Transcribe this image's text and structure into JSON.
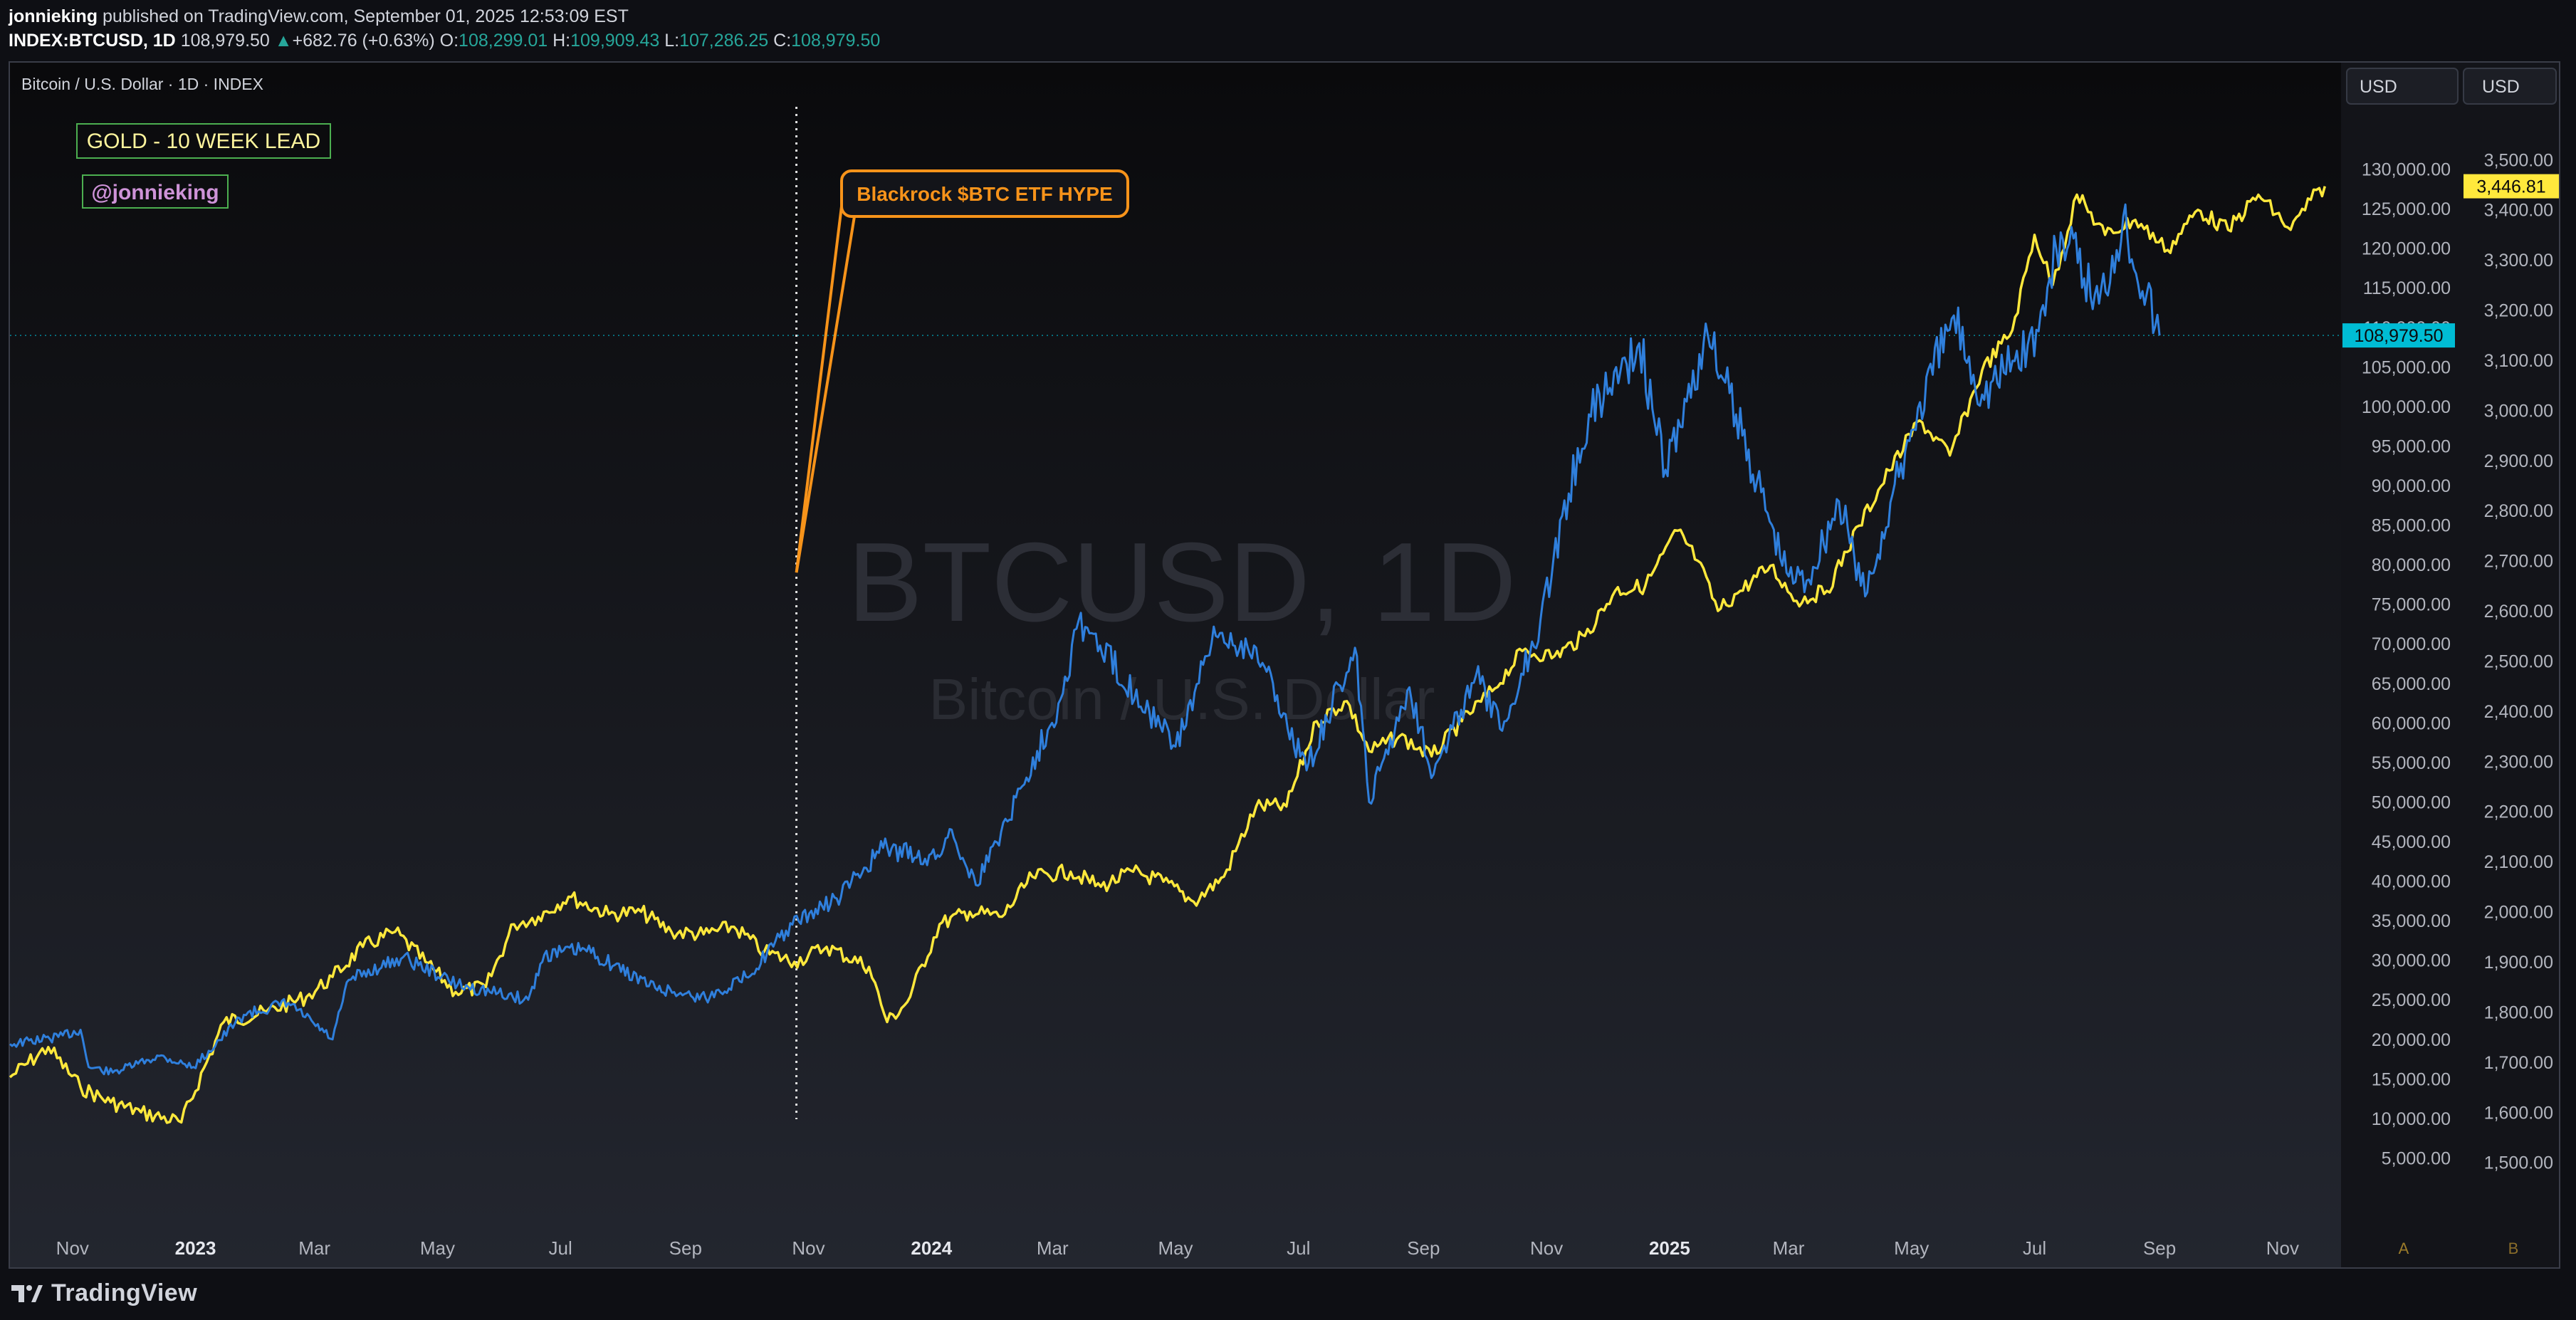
{
  "header": {
    "publisher": "jonnieking",
    "published_text": " published on TradingView.com, September 01, 2025 12:53:09 EST",
    "symbol": "INDEX:BTCUSD, 1D",
    "price": "108,979.50",
    "change_arrow": "▲",
    "change": "+682.76 (+0.63%)",
    "o_label": "O:",
    "o": "108,299.01",
    "h_label": "H:",
    "h": "109,909.43",
    "l_label": "L:",
    "l": "107,286.25",
    "c_label": "C:",
    "c": "108,979.50"
  },
  "pane": {
    "legend": "Bitcoin / U.S. Dollar · 1D · INDEX",
    "watermark_main": "BTCUSD, 1D",
    "watermark_sub": "Bitcoin / U.S. Dollar",
    "currency_left": "USD",
    "currency_right": "USD",
    "scale_label_a": "A",
    "scale_label_b": "B",
    "note_gold": "GOLD - 10 WEEK LEAD",
    "note_user": "@jonnieking",
    "callout": "Blackrock $BTC ETF HYPE",
    "last_price_btc": "108,979.50",
    "last_price_gold": "3,446.81"
  },
  "footer": {
    "logo_text": "TradingView"
  },
  "colors": {
    "btc": "#2f7fdc",
    "gold": "#ffe83c",
    "callout": "#f7931a",
    "last_btc_bg": "#00bcd4",
    "last_gold_bg": "#ffe83c",
    "note_border": "#4caf50",
    "note_user_text": "#ce93d8"
  },
  "chart_data": {
    "type": "line",
    "x_axis": {
      "range": [
        "2022-10-01",
        "2025-11-30"
      ],
      "ticks": [
        {
          "label": "Nov",
          "date": "2022-11-01"
        },
        {
          "label": "2023",
          "date": "2023-01-01",
          "bold": true
        },
        {
          "label": "Mar",
          "date": "2023-03-01"
        },
        {
          "label": "May",
          "date": "2023-05-01"
        },
        {
          "label": "Jul",
          "date": "2023-07-01"
        },
        {
          "label": "Sep",
          "date": "2023-09-01"
        },
        {
          "label": "Nov",
          "date": "2023-11-01"
        },
        {
          "label": "2024",
          "date": "2024-01-01",
          "bold": true
        },
        {
          "label": "Mar",
          "date": "2024-03-01"
        },
        {
          "label": "May",
          "date": "2024-05-01"
        },
        {
          "label": "Jul",
          "date": "2024-07-01"
        },
        {
          "label": "Sep",
          "date": "2024-09-01"
        },
        {
          "label": "Nov",
          "date": "2024-11-01"
        },
        {
          "label": "2025",
          "date": "2025-01-01",
          "bold": true
        },
        {
          "label": "Mar",
          "date": "2025-03-01"
        },
        {
          "label": "May",
          "date": "2025-05-01"
        },
        {
          "label": "Jul",
          "date": "2025-07-01"
        },
        {
          "label": "Sep",
          "date": "2025-09-01"
        },
        {
          "label": "Nov",
          "date": "2025-11-01"
        }
      ]
    },
    "y_left": {
      "unit": "USD",
      "range": [
        0,
        135000
      ],
      "ticks": [
        {
          "v": 5000,
          "label": "5,000.00"
        },
        {
          "v": 10000,
          "label": "10,000.00"
        },
        {
          "v": 15000,
          "label": "15,000.00"
        },
        {
          "v": 20000,
          "label": "20,000.00"
        },
        {
          "v": 25000,
          "label": "25,000.00"
        },
        {
          "v": 30000,
          "label": "30,000.00"
        },
        {
          "v": 35000,
          "label": "35,000.00"
        },
        {
          "v": 40000,
          "label": "40,000.00"
        },
        {
          "v": 45000,
          "label": "45,000.00"
        },
        {
          "v": 50000,
          "label": "50,000.00"
        },
        {
          "v": 55000,
          "label": "55,000.00"
        },
        {
          "v": 60000,
          "label": "60,000.00"
        },
        {
          "v": 65000,
          "label": "65,000.00"
        },
        {
          "v": 70000,
          "label": "70,000.00"
        },
        {
          "v": 75000,
          "label": "75,000.00"
        },
        {
          "v": 80000,
          "label": "80,000.00"
        },
        {
          "v": 85000,
          "label": "85,000.00"
        },
        {
          "v": 90000,
          "label": "90,000.00"
        },
        {
          "v": 95000,
          "label": "95,000.00"
        },
        {
          "v": 100000,
          "label": "100,000.00"
        },
        {
          "v": 105000,
          "label": "105,000.00"
        },
        {
          "v": 110000,
          "label": "110,000.00"
        },
        {
          "v": 115000,
          "label": "115,000.00"
        },
        {
          "v": 120000,
          "label": "120,000.00"
        },
        {
          "v": 125000,
          "label": "125,000.00"
        },
        {
          "v": 130000,
          "label": "130,000.00"
        }
      ]
    },
    "y_right": {
      "unit": "USD",
      "range": [
        1430,
        3560
      ],
      "ticks": [
        {
          "v": 1500,
          "label": "1,500.00"
        },
        {
          "v": 1600,
          "label": "1,600.00"
        },
        {
          "v": 1700,
          "label": "1,700.00"
        },
        {
          "v": 1800,
          "label": "1,800.00"
        },
        {
          "v": 1900,
          "label": "1,900.00"
        },
        {
          "v": 2000,
          "label": "2,000.00"
        },
        {
          "v": 2100,
          "label": "2,100.00"
        },
        {
          "v": 2200,
          "label": "2,200.00"
        },
        {
          "v": 2300,
          "label": "2,300.00"
        },
        {
          "v": 2400,
          "label": "2,400.00"
        },
        {
          "v": 2500,
          "label": "2,500.00"
        },
        {
          "v": 2600,
          "label": "2,600.00"
        },
        {
          "v": 2700,
          "label": "2,700.00"
        },
        {
          "v": 2800,
          "label": "2,800.00"
        },
        {
          "v": 2900,
          "label": "2,900.00"
        },
        {
          "v": 3000,
          "label": "3,000.00"
        },
        {
          "v": 3100,
          "label": "3,100.00"
        },
        {
          "v": 3200,
          "label": "3,200.00"
        },
        {
          "v": 3300,
          "label": "3,300.00"
        },
        {
          "v": 3400,
          "label": "3,400.00"
        },
        {
          "v": 3500,
          "label": "3,500.00"
        }
      ]
    },
    "series": [
      {
        "axis": "left",
        "points": [
          [
            "2022-10-01",
            19400
          ],
          [
            "2022-10-25",
            20300
          ],
          [
            "2022-11-05",
            21200
          ],
          [
            "2022-11-09",
            16500
          ],
          [
            "2022-11-21",
            15800
          ],
          [
            "2022-12-14",
            17900
          ],
          [
            "2022-12-31",
            16500
          ],
          [
            "2023-01-13",
            19900
          ],
          [
            "2023-01-25",
            23100
          ],
          [
            "2023-02-16",
            24600
          ],
          [
            "2023-03-10",
            20000
          ],
          [
            "2023-03-18",
            27500
          ],
          [
            "2023-04-14",
            30400
          ],
          [
            "2023-05-11",
            26900
          ],
          [
            "2023-06-15",
            25000
          ],
          [
            "2023-06-23",
            30700
          ],
          [
            "2023-07-13",
            31400
          ],
          [
            "2023-08-17",
            26500
          ],
          [
            "2023-09-11",
            25200
          ],
          [
            "2023-10-01",
            27900
          ],
          [
            "2023-10-24",
            34500
          ],
          [
            "2023-11-15",
            37800
          ],
          [
            "2023-12-08",
            44200
          ],
          [
            "2024-01-03",
            42800
          ],
          [
            "2024-01-11",
            46500
          ],
          [
            "2024-01-23",
            39500
          ],
          [
            "2024-02-15",
            52000
          ],
          [
            "2024-03-05",
            63000
          ],
          [
            "2024-03-14",
            73000
          ],
          [
            "2024-04-18",
            61500
          ],
          [
            "2024-05-01",
            57000
          ],
          [
            "2024-05-21",
            71000
          ],
          [
            "2024-06-10",
            69500
          ],
          [
            "2024-07-05",
            54000
          ],
          [
            "2024-07-29",
            69500
          ],
          [
            "2024-08-05",
            50000
          ],
          [
            "2024-08-25",
            64500
          ],
          [
            "2024-09-06",
            53500
          ],
          [
            "2024-09-27",
            66000
          ],
          [
            "2024-10-10",
            59000
          ],
          [
            "2024-10-29",
            73000
          ],
          [
            "2024-11-12",
            89000
          ],
          [
            "2024-11-22",
            99000
          ],
          [
            "2024-12-17",
            108000
          ],
          [
            "2024-12-30",
            92000
          ],
          [
            "2025-01-20",
            109000
          ],
          [
            "2025-02-03",
            99000
          ],
          [
            "2025-02-28",
            79000
          ],
          [
            "2025-03-10",
            78000
          ],
          [
            "2025-03-26",
            88000
          ],
          [
            "2025-04-08",
            76000
          ],
          [
            "2025-05-01",
            97000
          ],
          [
            "2025-05-22",
            111500
          ],
          [
            "2025-06-05",
            101500
          ],
          [
            "2025-07-03",
            109500
          ],
          [
            "2025-07-14",
            122000
          ],
          [
            "2025-08-02",
            113000
          ],
          [
            "2025-08-14",
            124000
          ],
          [
            "2025-09-01",
            108979
          ]
        ]
      },
      {
        "axis": "right",
        "points": [
          [
            "2022-10-01",
            1670
          ],
          [
            "2022-10-20",
            1730
          ],
          [
            "2022-11-05",
            1650
          ],
          [
            "2022-11-20",
            1620
          ],
          [
            "2022-12-05",
            1600
          ],
          [
            "2022-12-25",
            1580
          ],
          [
            "2023-01-15",
            1780
          ],
          [
            "2023-02-05",
            1800
          ],
          [
            "2023-02-25",
            1830
          ],
          [
            "2023-03-10",
            1870
          ],
          [
            "2023-03-25",
            1930
          ],
          [
            "2023-04-10",
            1960
          ],
          [
            "2023-04-25",
            1900
          ],
          [
            "2023-05-10",
            1840
          ],
          [
            "2023-05-25",
            1850
          ],
          [
            "2023-06-08",
            1975
          ],
          [
            "2023-06-20",
            1990
          ],
          [
            "2023-07-05",
            2030
          ],
          [
            "2023-07-25",
            1995
          ],
          [
            "2023-08-10",
            2000
          ],
          [
            "2023-08-25",
            1960
          ],
          [
            "2023-09-10",
            1955
          ],
          [
            "2023-09-25",
            1970
          ],
          [
            "2023-10-10",
            1920
          ],
          [
            "2023-10-25",
            1900
          ],
          [
            "2023-11-10",
            1930
          ],
          [
            "2023-12-01",
            1890
          ],
          [
            "2023-12-10",
            1780
          ],
          [
            "2023-12-20",
            1820
          ],
          [
            "2024-01-05",
            1975
          ],
          [
            "2024-01-20",
            2000
          ],
          [
            "2024-02-05",
            1990
          ],
          [
            "2024-02-20",
            2070
          ],
          [
            "2024-03-10",
            2080
          ],
          [
            "2024-03-25",
            2050
          ],
          [
            "2024-04-10",
            2080
          ],
          [
            "2024-04-25",
            2060
          ],
          [
            "2024-05-10",
            2020
          ],
          [
            "2024-05-25",
            2070
          ],
          [
            "2024-06-10",
            2210
          ],
          [
            "2024-06-25",
            2210
          ],
          [
            "2024-07-10",
            2380
          ],
          [
            "2024-07-25",
            2420
          ],
          [
            "2024-08-05",
            2320
          ],
          [
            "2024-08-20",
            2350
          ],
          [
            "2024-09-05",
            2310
          ],
          [
            "2024-09-20",
            2380
          ],
          [
            "2024-10-05",
            2440
          ],
          [
            "2024-10-20",
            2520
          ],
          [
            "2024-11-05",
            2510
          ],
          [
            "2024-11-20",
            2550
          ],
          [
            "2024-12-05",
            2640
          ],
          [
            "2024-12-20",
            2650
          ],
          [
            "2025-01-05",
            2760
          ],
          [
            "2025-01-15",
            2700
          ],
          [
            "2025-01-25",
            2600
          ],
          [
            "2025-02-05",
            2640
          ],
          [
            "2025-02-20",
            2690
          ],
          [
            "2025-03-05",
            2620
          ],
          [
            "2025-03-20",
            2640
          ],
          [
            "2025-04-05",
            2770
          ],
          [
            "2025-04-20",
            2880
          ],
          [
            "2025-05-05",
            2980
          ],
          [
            "2025-05-20",
            2910
          ],
          [
            "2025-06-05",
            3080
          ],
          [
            "2025-06-20",
            3160
          ],
          [
            "2025-07-01",
            3350
          ],
          [
            "2025-07-10",
            3250
          ],
          [
            "2025-07-22",
            3430
          ],
          [
            "2025-08-05",
            3350
          ],
          [
            "2025-08-20",
            3380
          ],
          [
            "2025-09-05",
            3320
          ],
          [
            "2025-09-20",
            3400
          ],
          [
            "2025-10-05",
            3360
          ],
          [
            "2025-10-20",
            3430
          ],
          [
            "2025-11-05",
            3360
          ],
          [
            "2025-11-15",
            3420
          ],
          [
            "2025-11-22",
            3447
          ]
        ]
      }
    ],
    "annotations": {
      "vline_date": "2023-10-26",
      "callout_anchor": {
        "date": "2023-10-26",
        "value": 79000
      }
    },
    "grid": false,
    "legend": "top-left"
  }
}
